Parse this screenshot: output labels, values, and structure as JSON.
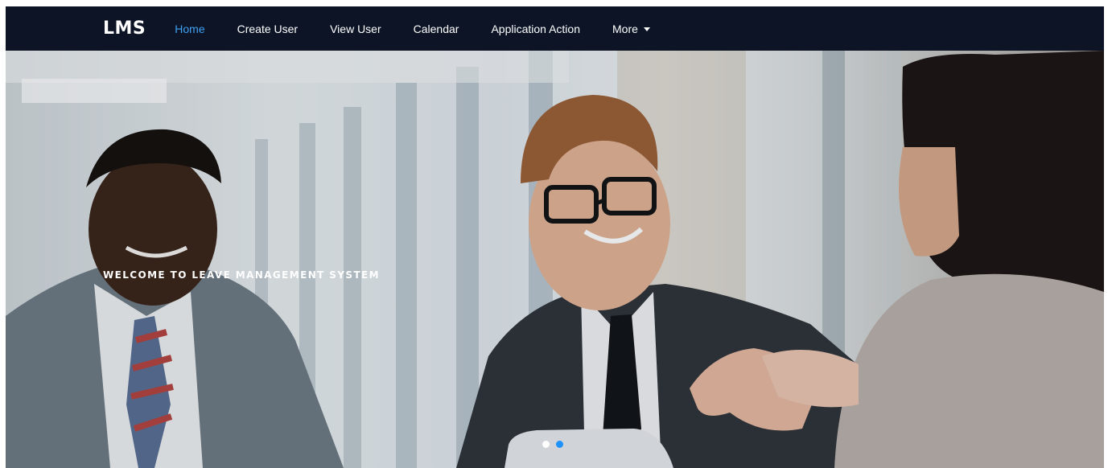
{
  "navbar": {
    "brand": "LMS",
    "items": [
      {
        "label": "Home",
        "active": true
      },
      {
        "label": "Create User",
        "active": false
      },
      {
        "label": "View User",
        "active": false
      },
      {
        "label": "Calendar",
        "active": false
      },
      {
        "label": "Application Action",
        "active": false
      },
      {
        "label": "More",
        "active": false,
        "icon": "caret-down-icon"
      }
    ]
  },
  "hero": {
    "caption": "WELCOME TO LEAVE MANAGEMENT SYSTEM",
    "slide_count": 2,
    "active_slide": 2
  },
  "colors": {
    "navbar_bg": "#0c1426",
    "nav_active": "#3ea1f2",
    "indicator_active": "#1e90ff"
  }
}
